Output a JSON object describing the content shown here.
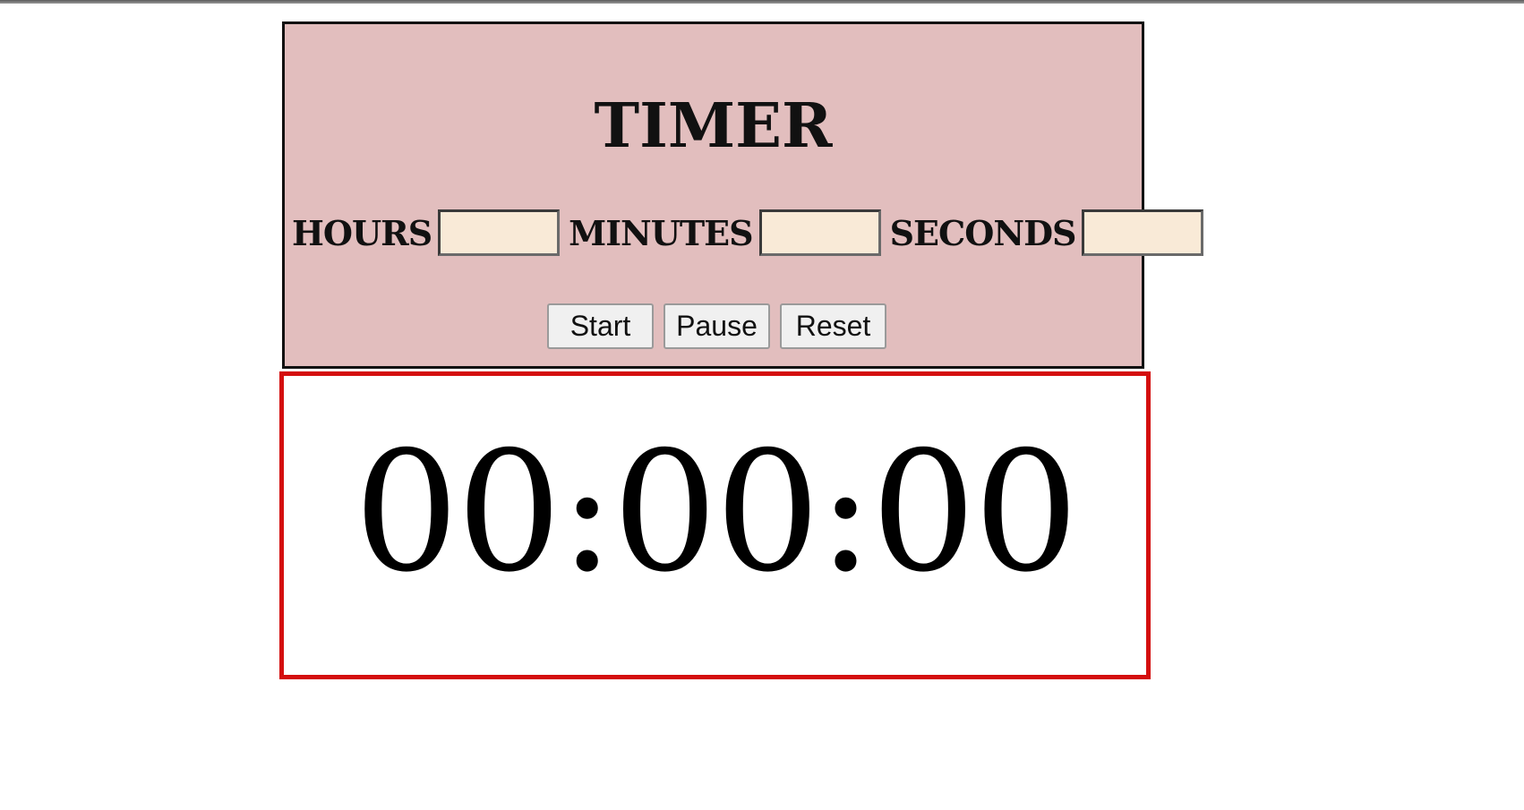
{
  "title": "TIMER",
  "fields": [
    {
      "label": "HOURS",
      "value": ""
    },
    {
      "label": "MINUTES",
      "value": ""
    },
    {
      "label": "SECONDS",
      "value": ""
    }
  ],
  "buttons": {
    "start": "Start",
    "pause": "Pause",
    "reset": "Reset"
  },
  "display": {
    "time": "00:00:00"
  },
  "colors": {
    "panel_background": "#e2bebe",
    "input_background": "#f9ead7",
    "display_border": "#d40e0e"
  }
}
